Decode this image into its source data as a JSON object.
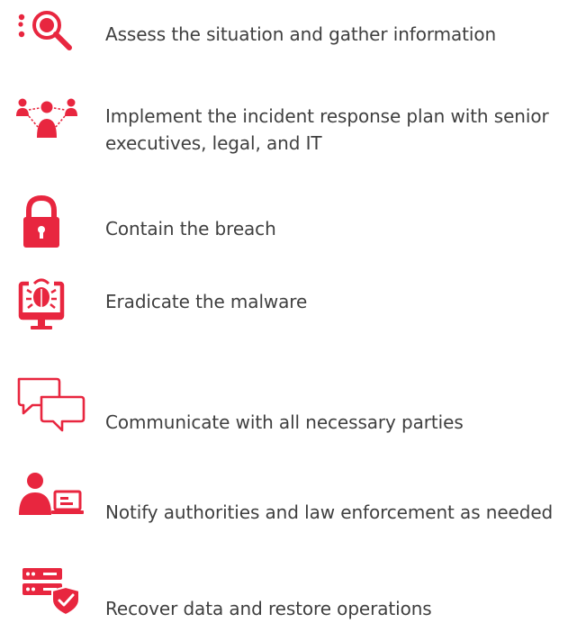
{
  "accent_color": "#e8263f",
  "text_color": "#3f3f3f",
  "steps": [
    {
      "icon": "magnifier-search-icon",
      "label": "Assess the situation and gather information"
    },
    {
      "icon": "team-people-icon",
      "label": "Implement the incident response plan with senior executives, legal, and IT"
    },
    {
      "icon": "padlock-icon",
      "label": "Contain the breach"
    },
    {
      "icon": "computer-bug-malware-icon",
      "label": "Eradicate the malware"
    },
    {
      "icon": "chat-bubbles-icon",
      "label": "Communicate with all necessary parties"
    },
    {
      "icon": "person-at-computer-icon",
      "label": "Notify authorities and law enforcement as needed"
    },
    {
      "icon": "server-shield-icon",
      "label": "Recover data and restore operations"
    }
  ]
}
